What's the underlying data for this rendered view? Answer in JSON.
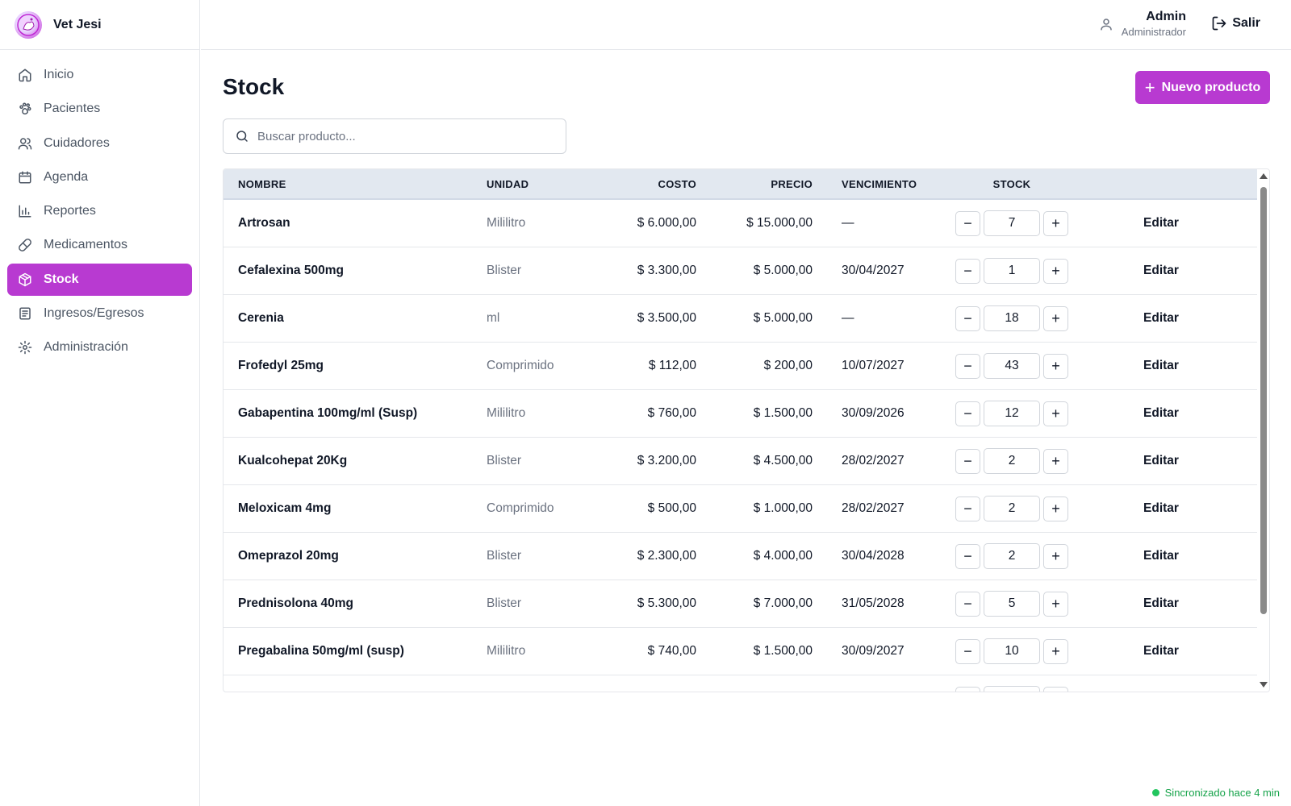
{
  "brand": {
    "name": "Vet Jesi"
  },
  "sidebar": {
    "items": [
      {
        "label": "Inicio",
        "icon": "home-icon"
      },
      {
        "label": "Pacientes",
        "icon": "paw-icon"
      },
      {
        "label": "Cuidadores",
        "icon": "users-icon"
      },
      {
        "label": "Agenda",
        "icon": "calendar-icon"
      },
      {
        "label": "Reportes",
        "icon": "bar-chart-icon"
      },
      {
        "label": "Medicamentos",
        "icon": "pill-icon"
      },
      {
        "label": "Stock",
        "icon": "package-icon",
        "active": true
      },
      {
        "label": "Ingresos/Egresos",
        "icon": "receipt-icon"
      },
      {
        "label": "Administración",
        "icon": "gear-icon"
      }
    ]
  },
  "header": {
    "user_name": "Admin",
    "user_role": "Administrador",
    "logout_label": "Salir"
  },
  "page": {
    "title": "Stock",
    "new_button_label": "Nuevo producto",
    "search_placeholder": "Buscar producto..."
  },
  "table": {
    "columns": [
      "NOMBRE",
      "UNIDAD",
      "COSTO",
      "PRECIO",
      "VENCIMIENTO",
      "STOCK"
    ],
    "edit_label": "Editar",
    "rows": [
      {
        "name": "Artrosan",
        "unit": "Mililitro",
        "cost": "$ 6.000,00",
        "price": "$ 15.000,00",
        "expiry": "—",
        "stock": "7"
      },
      {
        "name": "Cefalexina 500mg",
        "unit": "Blister",
        "cost": "$ 3.300,00",
        "price": "$ 5.000,00",
        "expiry": "30/04/2027",
        "stock": "1"
      },
      {
        "name": "Cerenia",
        "unit": "ml",
        "cost": "$ 3.500,00",
        "price": "$ 5.000,00",
        "expiry": "—",
        "stock": "18"
      },
      {
        "name": "Frofedyl 25mg",
        "unit": "Comprimido",
        "cost": "$ 112,00",
        "price": "$ 200,00",
        "expiry": "10/07/2027",
        "stock": "43"
      },
      {
        "name": "Gabapentina 100mg/ml (Susp)",
        "unit": "Mililitro",
        "cost": "$ 760,00",
        "price": "$ 1.500,00",
        "expiry": "30/09/2026",
        "stock": "12"
      },
      {
        "name": "Kualcohepat 20Kg",
        "unit": "Blister",
        "cost": "$ 3.200,00",
        "price": "$ 4.500,00",
        "expiry": "28/02/2027",
        "stock": "2"
      },
      {
        "name": "Meloxicam 4mg",
        "unit": "Comprimido",
        "cost": "$ 500,00",
        "price": "$ 1.000,00",
        "expiry": "28/02/2027",
        "stock": "2"
      },
      {
        "name": "Omeprazol 20mg",
        "unit": "Blister",
        "cost": "$ 2.300,00",
        "price": "$ 4.000,00",
        "expiry": "30/04/2028",
        "stock": "2"
      },
      {
        "name": "Prednisolona 40mg",
        "unit": "Blister",
        "cost": "$ 5.300,00",
        "price": "$ 7.000,00",
        "expiry": "31/05/2028",
        "stock": "5"
      },
      {
        "name": "Pregabalina 50mg/ml (susp)",
        "unit": "Mililitro",
        "cost": "$ 740,00",
        "price": "$ 1.500,00",
        "expiry": "30/09/2027",
        "stock": "10"
      }
    ]
  },
  "status": {
    "sync_text": "Sincronizado hace 4 min"
  },
  "colors": {
    "accent": "#b83ad1",
    "sync": "#16a34a"
  }
}
